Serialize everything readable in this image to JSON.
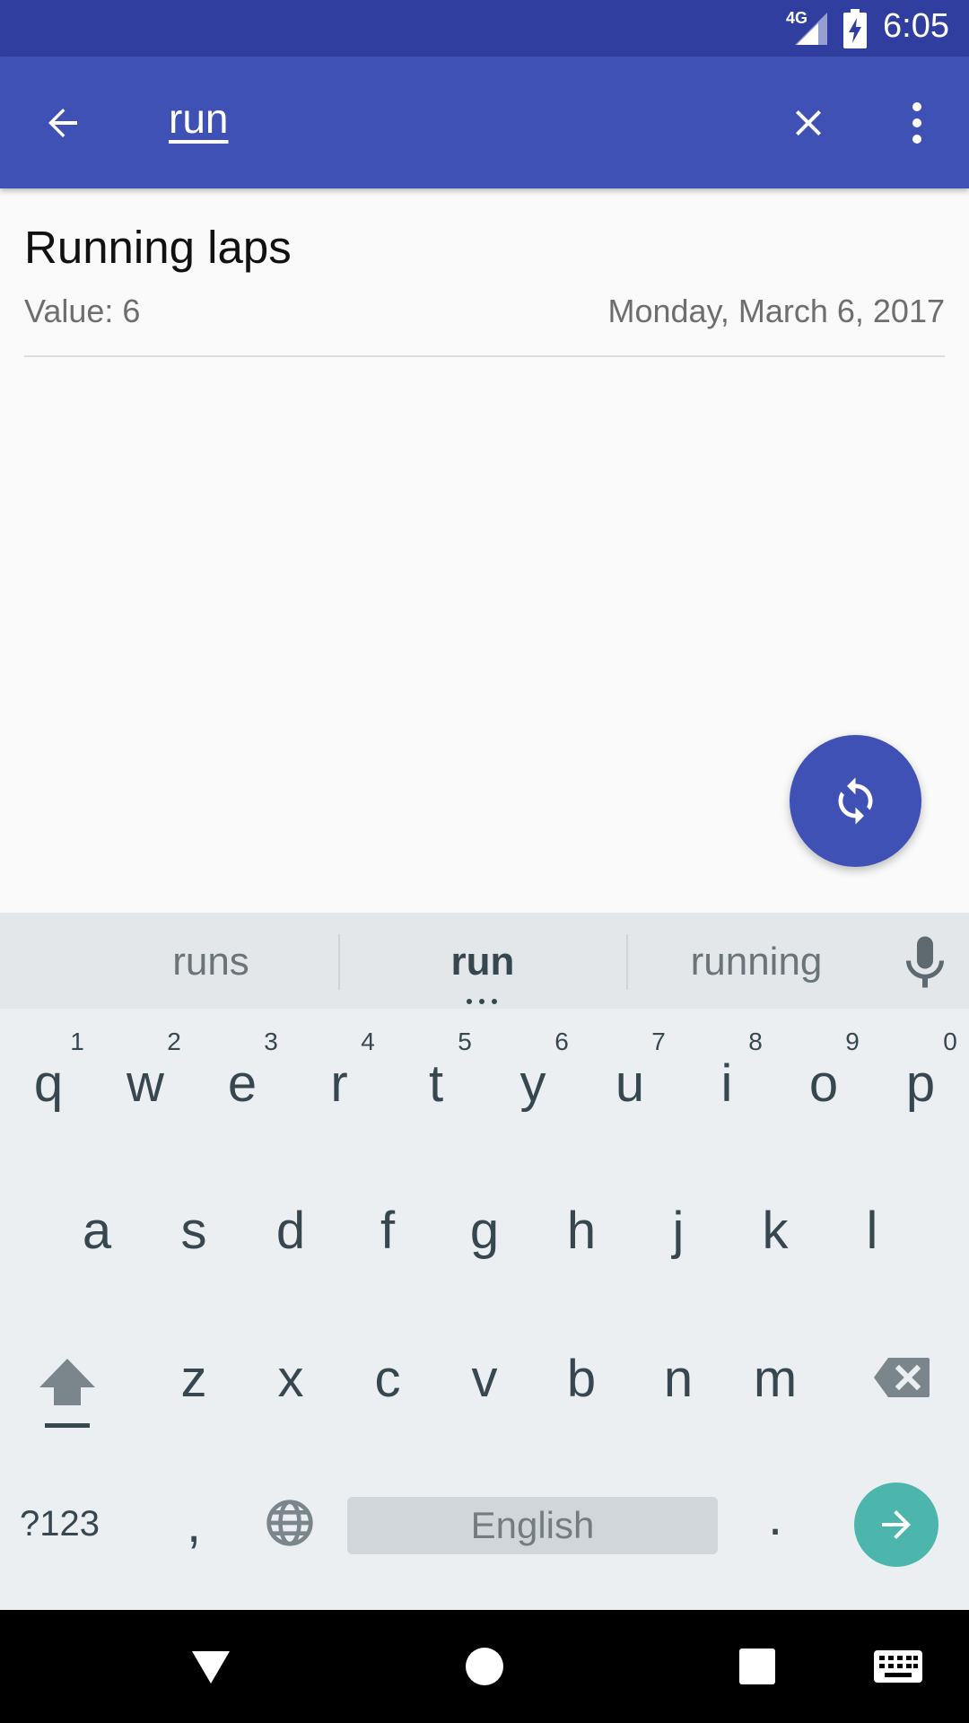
{
  "status_bar": {
    "time": "6:05",
    "network_label": "4G",
    "icons": [
      "signal-icon",
      "battery-charging-icon"
    ]
  },
  "toolbar": {
    "back_icon": "arrow-back-icon",
    "search_query": "run",
    "clear_icon": "close-icon",
    "overflow_icon": "more-vert-icon"
  },
  "results": [
    {
      "title": "Running laps",
      "value": "Value: 6",
      "date": "Monday, March 6, 2017"
    }
  ],
  "fab": {
    "icon": "sync-icon"
  },
  "keyboard": {
    "suggestions": [
      "runs",
      "run",
      "running"
    ],
    "row1": [
      "q",
      "w",
      "e",
      "r",
      "t",
      "y",
      "u",
      "i",
      "o",
      "p"
    ],
    "row1_hints": [
      "1",
      "2",
      "3",
      "4",
      "5",
      "6",
      "7",
      "8",
      "9",
      "0"
    ],
    "row2": [
      "a",
      "s",
      "d",
      "f",
      "g",
      "h",
      "j",
      "k",
      "l"
    ],
    "row3": [
      "z",
      "x",
      "c",
      "v",
      "b",
      "n",
      "m"
    ],
    "symbols_label": "?123",
    "comma": ",",
    "period": ".",
    "space_label": "English",
    "icons": [
      "mic-icon",
      "shift-icon",
      "backspace-icon",
      "globe-icon",
      "enter-arrow-icon"
    ]
  },
  "colors": {
    "status_bar": "#303f9f",
    "primary": "#3f51b5",
    "accent_enter": "#4db6ac"
  }
}
